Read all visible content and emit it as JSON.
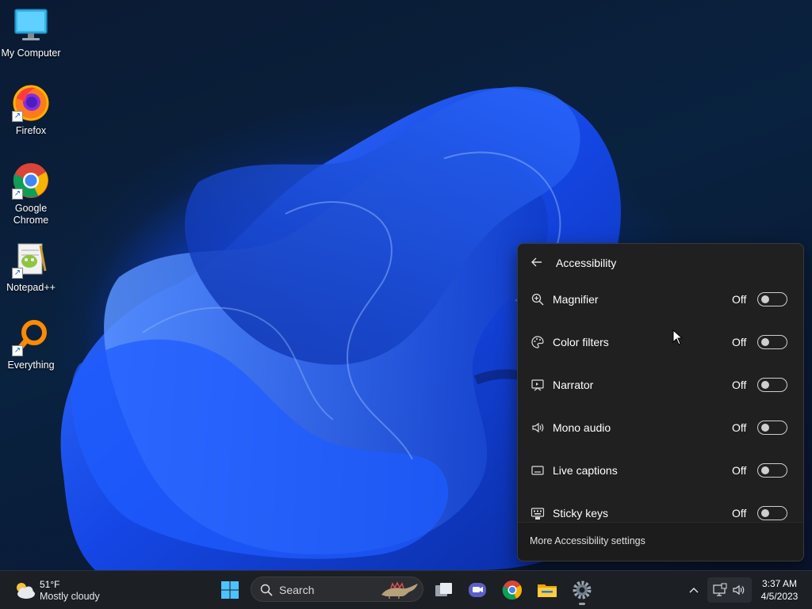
{
  "desktop": {
    "icons": [
      {
        "label": "My Computer",
        "icon": "monitor-icon"
      },
      {
        "label": "Firefox",
        "icon": "firefox-icon"
      },
      {
        "label": "Google Chrome",
        "icon": "chrome-icon"
      },
      {
        "label": "Notepad++",
        "icon": "notepadpp-icon"
      },
      {
        "label": "Everything",
        "icon": "everything-icon"
      }
    ]
  },
  "panel": {
    "title": "Accessibility",
    "rows": [
      {
        "label": "Magnifier",
        "state": "Off",
        "icon": "magnifier-icon"
      },
      {
        "label": "Color filters",
        "state": "Off",
        "icon": "color-filters-icon"
      },
      {
        "label": "Narrator",
        "state": "Off",
        "icon": "narrator-icon"
      },
      {
        "label": "Mono audio",
        "state": "Off",
        "icon": "mono-audio-icon"
      },
      {
        "label": "Live captions",
        "state": "Off",
        "icon": "live-captions-icon"
      },
      {
        "label": "Sticky keys",
        "state": "Off",
        "icon": "sticky-keys-icon"
      }
    ],
    "footer_link": "More Accessibility settings"
  },
  "taskbar": {
    "weather": {
      "temp": "51°F",
      "condition": "Mostly cloudy",
      "icon": "cloudy-icon"
    },
    "search_label": "Search",
    "clock": {
      "time": "3:37 AM",
      "date": "4/5/2023"
    },
    "colors": {
      "accent": "#0078d4",
      "taskbar_bg": "#1c1f24"
    }
  }
}
